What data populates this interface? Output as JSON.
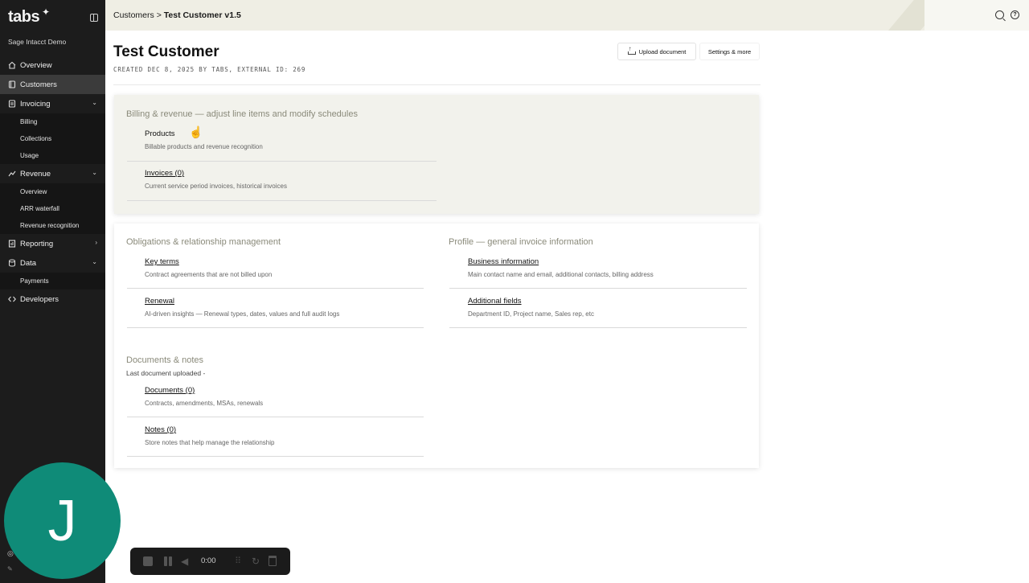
{
  "brand": {
    "logo": "tabs",
    "org": "Sage Intacct Demo"
  },
  "sidebar": {
    "items": [
      {
        "label": "Overview",
        "icon": "home-icon"
      },
      {
        "label": "Customers",
        "icon": "customers-icon",
        "active": true
      },
      {
        "label": "Invoicing",
        "icon": "invoice-icon",
        "expanded": true,
        "children": [
          "Billing",
          "Collections",
          "Usage"
        ]
      },
      {
        "label": "Revenue",
        "icon": "revenue-icon",
        "expanded": true,
        "children": [
          "Overview",
          "ARR waterfall",
          "Revenue recognition"
        ]
      },
      {
        "label": "Reporting",
        "icon": "chart-icon"
      },
      {
        "label": "Data",
        "icon": "database-icon",
        "expanded": true,
        "children": [
          "Payments"
        ]
      },
      {
        "label": "Developers",
        "icon": "code-icon"
      }
    ]
  },
  "topbar": {
    "crumb_parent": "Customers",
    "crumb_sep": ">",
    "crumb_current": "Test Customer v1.5"
  },
  "header": {
    "title": "Test Customer",
    "meta": "CREATED DEC 8, 2025 BY TABS, EXTERNAL ID: 269",
    "upload_label": "Upload document",
    "settings_label": "Settings & more"
  },
  "billing": {
    "title": "Billing & revenue — adjust line items and modify schedules",
    "items": [
      {
        "title": "Products",
        "desc": "Billable products and revenue recognition"
      },
      {
        "title": "Invoices (0)",
        "desc": "Current service period invoices, historical invoices"
      }
    ]
  },
  "obligations": {
    "title": "Obligations & relationship management",
    "items": [
      {
        "title": "Key terms",
        "desc": "Contract agreements that are not billed upon"
      },
      {
        "title": "Renewal",
        "desc": "AI-driven insights — Renewal types, dates, values and full audit logs"
      }
    ]
  },
  "profile": {
    "title": "Profile — general invoice information",
    "items": [
      {
        "title": "Business information",
        "desc": "Main contact name and email, additional contacts, billing address"
      },
      {
        "title": "Additional fields",
        "desc": "Department ID, Project name, Sales rep, etc"
      }
    ]
  },
  "documents": {
    "title": "Documents & notes",
    "subtitle": "Last document uploaded -",
    "items": [
      {
        "title": "Documents (0)",
        "desc": "Contracts, amendments, MSAs, renewals"
      },
      {
        "title": "Notes (0)",
        "desc": "Store notes that help manage the relationship"
      }
    ]
  },
  "recorder": {
    "time": "0:00",
    "avatar_letter": "J"
  },
  "colors": {
    "sidebar": "#1c1c1c",
    "topbar": "#efeee4",
    "avatar": "#0f8b78",
    "section_title": "#8a8a7a"
  }
}
